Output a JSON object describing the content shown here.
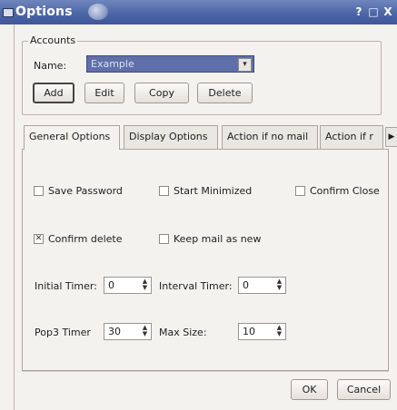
{
  "window": {
    "title": "Options",
    "buttons": [
      "?",
      "□",
      "X"
    ]
  },
  "accounts": {
    "legend": "Accounts",
    "name_label": "Name:",
    "name_value": "Example",
    "add_label": "Add",
    "edit_label": "Edit",
    "copy_label": "Copy",
    "delete_label": "Delete"
  },
  "tabs": [
    {
      "label": "General Options",
      "active": true
    },
    {
      "label": "Display Options",
      "active": false
    },
    {
      "label": "Action if no mail",
      "active": false
    },
    {
      "label": "Action if r",
      "active": false
    }
  ],
  "general": {
    "save_password": {
      "label": "Save Password",
      "checked": false
    },
    "start_minimized": {
      "label": "Start Minimized",
      "checked": false
    },
    "confirm_close": {
      "label": "Confirm Close",
      "checked": false
    },
    "confirm_delete": {
      "label": "Confirm delete",
      "checked": true
    },
    "keep_mail_as_new": {
      "label": "Keep mail as new",
      "checked": false
    },
    "initial_timer": {
      "label": "Initial Timer:",
      "value": "0"
    },
    "interval_timer": {
      "label": "Interval Timer:",
      "value": "0"
    },
    "pop3_timer": {
      "label": "Pop3 Timer",
      "value": "30"
    },
    "max_size": {
      "label": "Max Size:",
      "value": "10"
    }
  },
  "footer": {
    "ok_label": "OK",
    "cancel_label": "Cancel"
  }
}
